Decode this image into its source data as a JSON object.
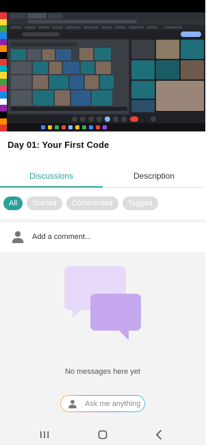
{
  "lesson": {
    "title": "Day 01: Your First Code"
  },
  "tabs": [
    {
      "label": "Discussions",
      "active": true
    },
    {
      "label": "Description",
      "active": false
    }
  ],
  "filters": [
    {
      "label": "All",
      "active": true
    },
    {
      "label": "Started",
      "active": false
    },
    {
      "label": "Commented",
      "active": false
    },
    {
      "label": "Tagged",
      "active": false
    }
  ],
  "comment": {
    "placeholder": "Add a comment..."
  },
  "empty_state": {
    "message": "No messages here yet"
  },
  "assistant": {
    "label": "Ask me anything"
  },
  "nav": {
    "recents": "recents-icon",
    "home": "home-icon",
    "back": "back-icon"
  },
  "colors": {
    "accent": "#2aa197",
    "chip_inactive": "#dcdcdc",
    "bubble_back": "#e6d9fa",
    "bubble_front": "#c6a8ef"
  }
}
